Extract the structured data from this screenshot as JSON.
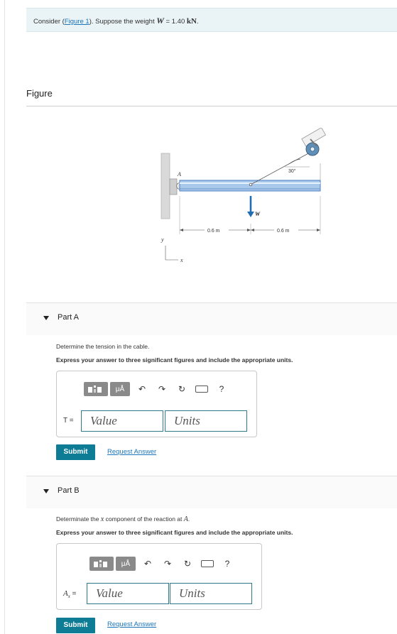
{
  "intro": {
    "prefix": "Consider (",
    "link": "Figure 1",
    "mid": "). Suppose the weight ",
    "var": "W",
    "eq": " = 1.40 ",
    "unit": "kN",
    "suffix": "."
  },
  "figure": {
    "title": "Figure",
    "label_A": "A",
    "label_W": "W",
    "dim_left": "0.6 m",
    "dim_right": "0.6 m",
    "angle": "30°",
    "axis_y": "y",
    "axis_x": "x"
  },
  "toolbar": {
    "mu": "μÅ",
    "undo": "↶",
    "redo": "↷",
    "refresh": "↻",
    "help": "?"
  },
  "partA": {
    "label": "Part A",
    "prompt": "Determine the tension in the cable.",
    "instruction": "Express your answer to three significant figures and include the appropriate units.",
    "field_label": "T =",
    "value_placeholder": "Value",
    "units_placeholder": "Units",
    "submit": "Submit",
    "request": "Request Answer"
  },
  "partB": {
    "label": "Part B",
    "prompt_prefix": "Determinate the ",
    "prompt_var": "x",
    "prompt_mid": " component of the reaction at ",
    "prompt_point": "A",
    "prompt_suffix": ".",
    "instruction": "Express your answer to three significant figures and include the appropriate units.",
    "field_label_var": "A",
    "field_label_sub": "x",
    "field_label_eq": " =",
    "value_placeholder": "Value",
    "units_placeholder": "Units",
    "submit": "Submit",
    "request": "Request Answer"
  }
}
